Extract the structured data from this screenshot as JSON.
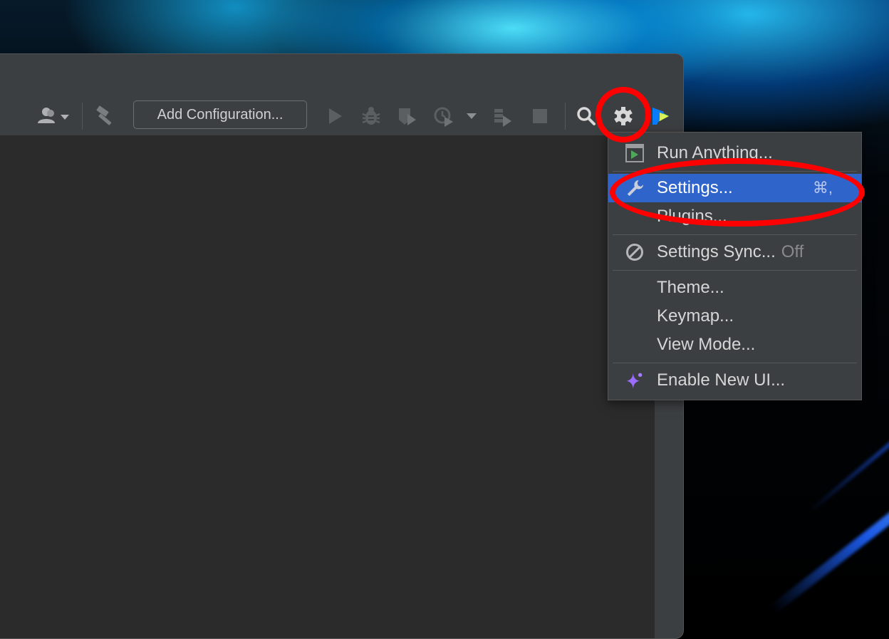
{
  "toolbar": {
    "add_configuration_label": "Add Configuration...",
    "icons": [
      "account-icon",
      "build-hammer-icon",
      "run-icon",
      "debug-icon",
      "coverage-icon",
      "profile-icon",
      "attach-icon",
      "stop-icon",
      "search-icon",
      "gear-icon",
      "jetbrains-ai-icon"
    ]
  },
  "menu": {
    "items": [
      {
        "label": "Run Anything...",
        "icon": "run-anything-icon"
      },
      {
        "label": "Settings...",
        "icon": "wrench-icon",
        "shortcut": "⌘,",
        "active": true
      },
      {
        "label": "Plugins..."
      },
      {
        "label": "Settings Sync...",
        "icon": "disabled-icon",
        "status": "Off"
      },
      {
        "label": "Theme..."
      },
      {
        "label": "Keymap..."
      },
      {
        "label": "View Mode..."
      },
      {
        "label": "Enable New UI...",
        "icon": "sparkle-icon"
      }
    ]
  },
  "colors": {
    "accent": "#2f65ca",
    "annotation": "#ff0000",
    "window_bg": "#3c3f41",
    "editor_bg": "#2b2b2b"
  }
}
